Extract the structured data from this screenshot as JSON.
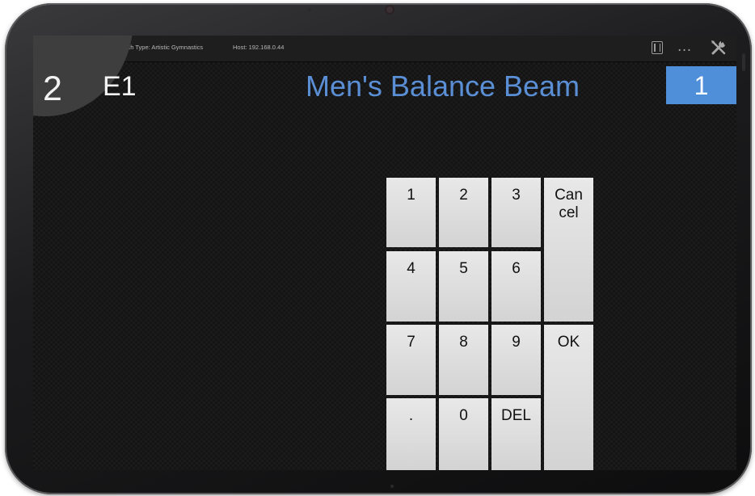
{
  "statusbar": {
    "wifi_icon": "((ꞏꞏ))",
    "match_type": "Match Type: Artistic Gymnastics",
    "host": "Host: 192.168.0.44",
    "more": "..."
  },
  "header": {
    "panel_number": "2",
    "judge": "E1",
    "event_title": "Men's Balance Beam",
    "rotation": "1"
  },
  "colors": {
    "accent": "#4f8fda",
    "title": "#5a8fd6"
  },
  "keypad": {
    "k1": "1",
    "k2": "2",
    "k3": "3",
    "k4": "4",
    "k5": "5",
    "k6": "6",
    "k7": "7",
    "k8": "8",
    "k9": "9",
    "kdot": ".",
    "k0": "0",
    "del": "DEL",
    "cancel": "Can\ncel",
    "ok": "OK"
  }
}
